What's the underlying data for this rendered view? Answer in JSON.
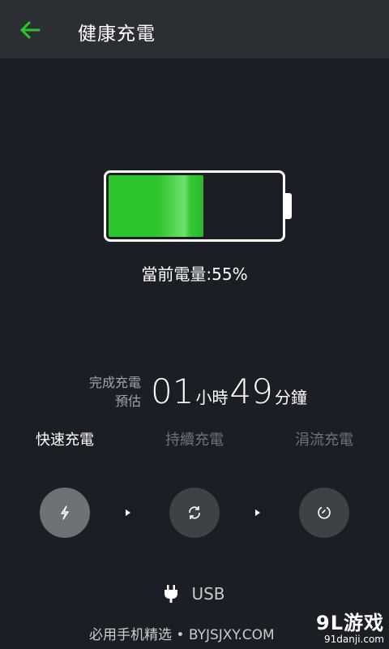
{
  "header": {
    "title": "健康充電",
    "back_icon": "arrow-left-icon",
    "accent": "#2ec42e"
  },
  "battery": {
    "level_fraction": 0.55,
    "level_label": "當前電量",
    "level_value": ":55%"
  },
  "estimate": {
    "label_line1": "完成充電",
    "label_line2": "預估",
    "hours": "01",
    "hours_unit": "小時",
    "minutes": "49",
    "minutes_unit": "分鐘"
  },
  "modes": [
    {
      "label": "快速充電",
      "icon": "lightning-icon",
      "active": true
    },
    {
      "label": "持續充電",
      "icon": "refresh-icon",
      "active": false
    },
    {
      "label": "涓流充電",
      "icon": "trickle-icon",
      "active": false
    }
  ],
  "source": {
    "icon": "plug-icon",
    "label": "USB"
  },
  "footer": {
    "text": "必用手机精选 • BYJSJXY.COM"
  },
  "watermark": {
    "name": "9L游戏",
    "url": "91danji.com"
  }
}
